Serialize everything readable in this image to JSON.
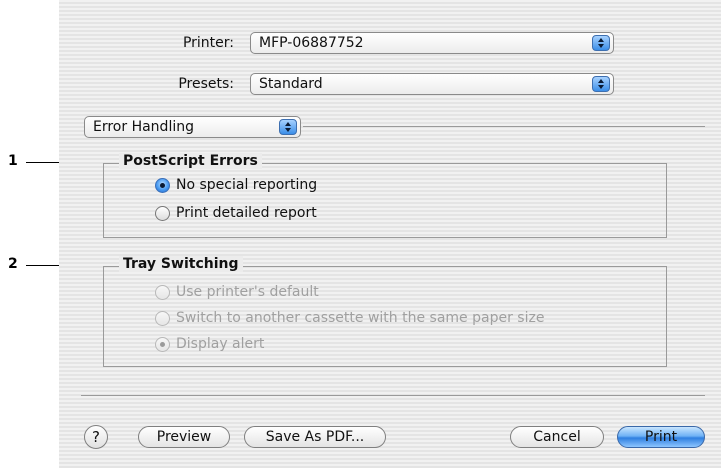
{
  "printer": {
    "label": "Printer:",
    "value": "MFP-06887752"
  },
  "presets": {
    "label": "Presets:",
    "value": "Standard"
  },
  "panel_selector": {
    "value": "Error Handling"
  },
  "callouts": {
    "first": "1",
    "second": "2"
  },
  "postscript_errors": {
    "title": "PostScript Errors",
    "options": [
      "No special reporting",
      "Print detailed report"
    ],
    "selected": 0
  },
  "tray_switching": {
    "title": "Tray Switching",
    "options": [
      "Use printer's default",
      "Switch to another cassette with the same paper size",
      "Display alert"
    ],
    "selected": 2,
    "disabled": true
  },
  "buttons": {
    "help": "?",
    "preview": "Preview",
    "save_pdf": "Save As PDF...",
    "cancel": "Cancel",
    "print": "Print"
  },
  "icons": {
    "help": "question-mark-icon",
    "popup": "stepper-arrows-icon",
    "radio": "radio-button-icon"
  },
  "colors": {
    "accent": "#3a8ee8"
  }
}
